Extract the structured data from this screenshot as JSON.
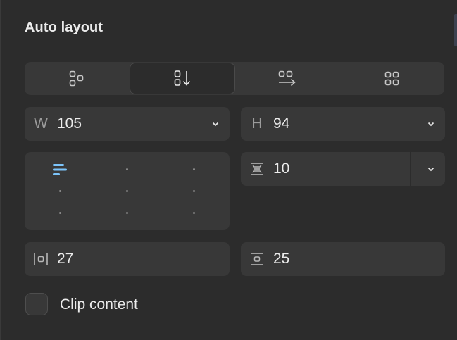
{
  "panel": {
    "title": "Auto layout"
  },
  "direction": {
    "options": [
      {
        "name": "none",
        "icon": "freeform-layout-icon",
        "selected": false
      },
      {
        "name": "vertical",
        "icon": "vertical-layout-icon",
        "selected": true
      },
      {
        "name": "horizontal",
        "icon": "horizontal-layout-icon",
        "selected": false
      },
      {
        "name": "wrap",
        "icon": "grid-layout-icon",
        "selected": false
      }
    ]
  },
  "size": {
    "width_label": "W",
    "width_value": "105",
    "height_label": "H",
    "height_value": "94"
  },
  "alignment": {
    "selected": "top-left",
    "accent_color": "#7cc4fa"
  },
  "gap": {
    "value": "10",
    "icon": "vertical-gap-icon"
  },
  "padding": {
    "horizontal_value": "27",
    "horizontal_icon": "horizontal-padding-icon",
    "vertical_value": "25",
    "vertical_icon": "vertical-padding-icon"
  },
  "clip": {
    "label": "Clip content",
    "checked": false
  }
}
